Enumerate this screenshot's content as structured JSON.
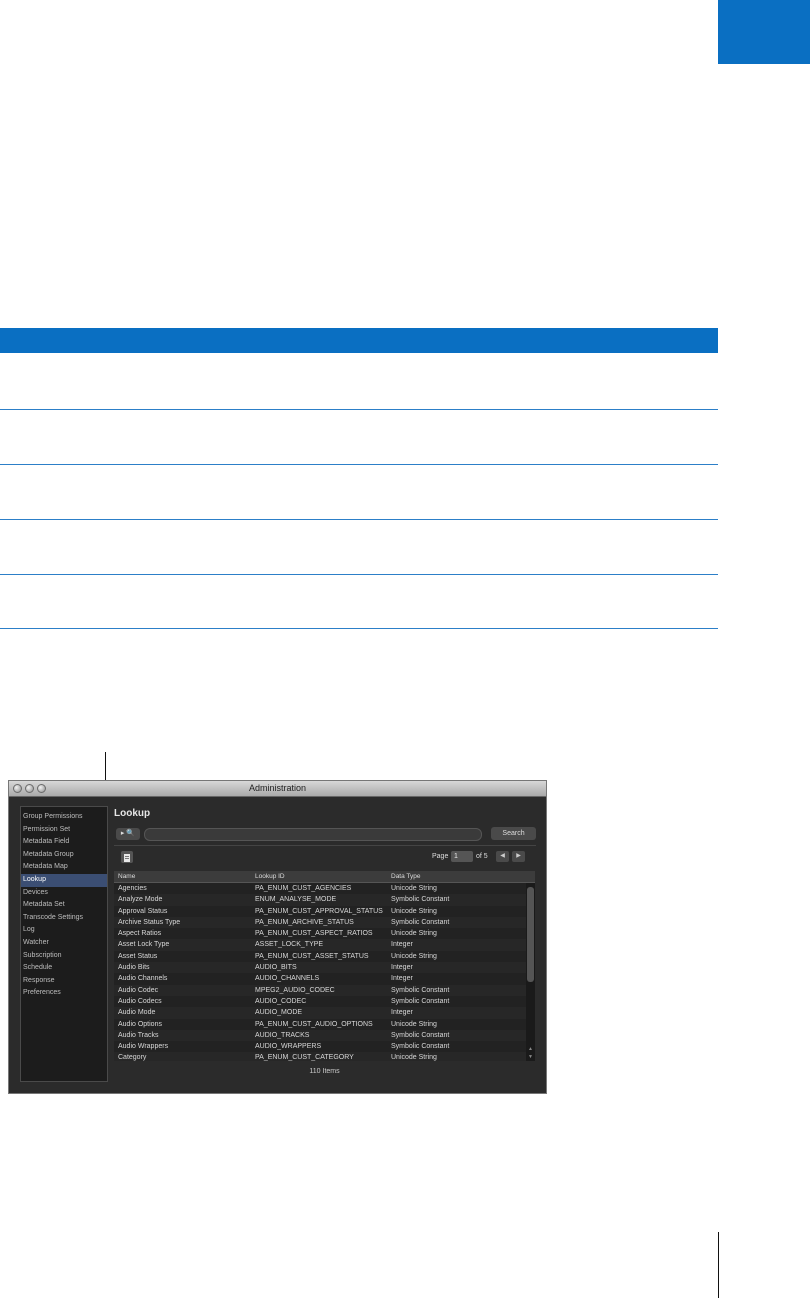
{
  "window": {
    "title": "Administration"
  },
  "sidebar": {
    "items": [
      {
        "label": "Group Permissions",
        "selected": false
      },
      {
        "label": "Permission Set",
        "selected": false
      },
      {
        "label": "Metadata Field",
        "selected": false
      },
      {
        "label": "Metadata Group",
        "selected": false
      },
      {
        "label": "Metadata Map",
        "selected": false
      },
      {
        "label": "Lookup",
        "selected": true
      },
      {
        "label": "Devices",
        "selected": false
      },
      {
        "label": "Metadata Set",
        "selected": false
      },
      {
        "label": "Transcode Settings",
        "selected": false
      },
      {
        "label": "Log",
        "selected": false
      },
      {
        "label": "Watcher",
        "selected": false
      },
      {
        "label": "Subscription",
        "selected": false
      },
      {
        "label": "Schedule",
        "selected": false
      },
      {
        "label": "Response",
        "selected": false
      },
      {
        "label": "Preferences",
        "selected": false
      }
    ]
  },
  "main": {
    "title": "Lookup",
    "search": {
      "mode_icon": "▸ 🔍",
      "value": "",
      "button_label": "Search"
    },
    "pagination": {
      "page_label": "Page",
      "page_value": "1",
      "of_label": "of 5",
      "prev_icon": "◀",
      "next_icon": "▶"
    }
  },
  "table": {
    "columns": [
      "Name",
      "Lookup ID",
      "Data Type"
    ],
    "rows": [
      [
        "Agencies",
        "PA_ENUM_CUST_AGENCIES",
        "Unicode String"
      ],
      [
        "Analyze Mode",
        "ENUM_ANALYSE_MODE",
        "Symbolic Constant"
      ],
      [
        "Approval Status",
        "PA_ENUM_CUST_APPROVAL_STATUS",
        "Unicode String"
      ],
      [
        "Archive Status Type",
        "PA_ENUM_ARCHIVE_STATUS",
        "Symbolic Constant"
      ],
      [
        "Aspect Ratios",
        "PA_ENUM_CUST_ASPECT_RATIOS",
        "Unicode String"
      ],
      [
        "Asset Lock Type",
        "ASSET_LOCK_TYPE",
        "Integer"
      ],
      [
        "Asset Status",
        "PA_ENUM_CUST_ASSET_STATUS",
        "Unicode String"
      ],
      [
        "Audio Bits",
        "AUDIO_BITS",
        "Integer"
      ],
      [
        "Audio Channels",
        "AUDIO_CHANNELS",
        "Integer"
      ],
      [
        "Audio Codec",
        "MPEG2_AUDIO_CODEC",
        "Symbolic Constant"
      ],
      [
        "Audio Codecs",
        "AUDIO_CODEC",
        "Symbolic Constant"
      ],
      [
        "Audio Mode",
        "AUDIO_MODE",
        "Integer"
      ],
      [
        "Audio Options",
        "PA_ENUM_CUST_AUDIO_OPTIONS",
        "Unicode String"
      ],
      [
        "Audio Tracks",
        "AUDIO_TRACKS",
        "Symbolic Constant"
      ],
      [
        "Audio Wrappers",
        "AUDIO_WRAPPERS",
        "Symbolic Constant"
      ],
      [
        "Category",
        "PA_ENUM_CUST_CATEGORY",
        "Unicode String"
      ]
    ],
    "items_count": "110 Items"
  },
  "colors": {
    "accent": "#0a6fc2",
    "selection": "#3b4e73"
  }
}
